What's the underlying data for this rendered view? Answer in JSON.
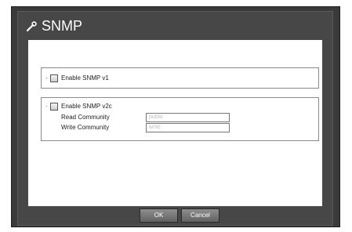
{
  "dialog": {
    "title": "SNMP"
  },
  "snmp_v1": {
    "label": "Enable SNMP v1",
    "checked": false
  },
  "snmp_v2c": {
    "label": "Enable SNMP v2c",
    "checked": false,
    "read_community": {
      "label": "Read Community",
      "value": "public"
    },
    "write_community": {
      "label": "Write Community",
      "value": "write"
    }
  },
  "buttons": {
    "ok_label": "OK",
    "cancel_label": "Cancel"
  },
  "icons": {
    "title_icon": "wrench-icon"
  },
  "colors": {
    "dialog_bg": "#474747",
    "frame_bg": "#3a3a3a",
    "content_bg": "#ffffff",
    "button_bg": "#6f6f6f"
  }
}
